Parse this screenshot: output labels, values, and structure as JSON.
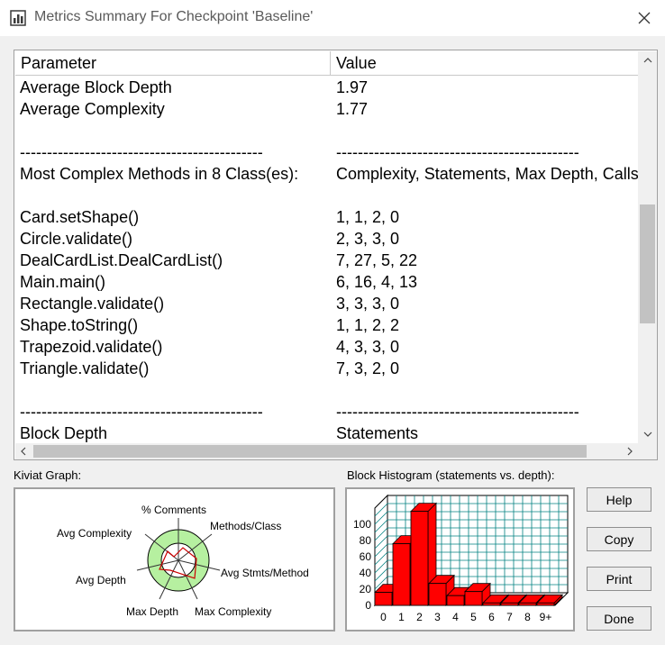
{
  "window": {
    "title": "Metrics Summary For Checkpoint 'Baseline'",
    "icon": "chart-app-icon",
    "close_icon": "close-icon"
  },
  "table": {
    "headers": {
      "parameter": "Parameter",
      "value": "Value"
    },
    "rows": [
      {
        "parameter": "Average Block Depth",
        "value": "1.97"
      },
      {
        "parameter": "Average Complexity",
        "value": "1.77"
      },
      {
        "parameter": "",
        "value": ""
      },
      {
        "parameter": "---------------------------------------------",
        "value": "---------------------------------------------"
      },
      {
        "parameter": "Most Complex Methods in 8 Class(es):",
        "value": "Complexity, Statements, Max Depth, Calls"
      },
      {
        "parameter": "",
        "value": ""
      },
      {
        "parameter": "Card.setShape()",
        "value": "1, 1, 2, 0"
      },
      {
        "parameter": "Circle.validate()",
        "value": "2, 3, 3, 0"
      },
      {
        "parameter": "DealCardList.DealCardList()",
        "value": "7, 27, 5, 22"
      },
      {
        "parameter": "Main.main()",
        "value": "6, 16, 4, 13"
      },
      {
        "parameter": "Rectangle.validate()",
        "value": "3, 3, 3, 0"
      },
      {
        "parameter": "Shape.toString()",
        "value": "1, 1, 2, 2"
      },
      {
        "parameter": "Trapezoid.validate()",
        "value": "4, 3, 3, 0"
      },
      {
        "parameter": "Triangle.validate()",
        "value": "7, 3, 2, 0"
      },
      {
        "parameter": "",
        "value": ""
      },
      {
        "parameter": "---------------------------------------------",
        "value": "---------------------------------------------"
      },
      {
        "parameter": "Block Depth",
        "value": "Statements"
      }
    ]
  },
  "kiviat": {
    "label": "Kiviat Graph:",
    "axes": [
      "% Comments",
      "Methods/Class",
      "Avg Stmts/Method",
      "Max Complexity",
      "Max Depth",
      "Avg Depth",
      "Avg Complexity"
    ]
  },
  "histogram": {
    "label": "Block Histogram (statements vs. depth):",
    "y_ticks": [
      "0",
      "20",
      "40",
      "60",
      "80",
      "100"
    ],
    "colors": {
      "bar": "#ff0000",
      "grid": "#008080"
    }
  },
  "buttons": {
    "help": "Help",
    "copy": "Copy",
    "print": "Print",
    "done": "Done"
  },
  "chart_data": {
    "type": "bar",
    "title": "Block Histogram (statements vs. depth):",
    "xlabel": "",
    "ylabel": "",
    "categories": [
      "0",
      "1",
      "2",
      "3",
      "4",
      "5",
      "6",
      "7",
      "8",
      "9+"
    ],
    "values": [
      16,
      76,
      116,
      27,
      12,
      17,
      3,
      3,
      3,
      3
    ],
    "ylim": [
      0,
      120
    ],
    "grid": true
  }
}
